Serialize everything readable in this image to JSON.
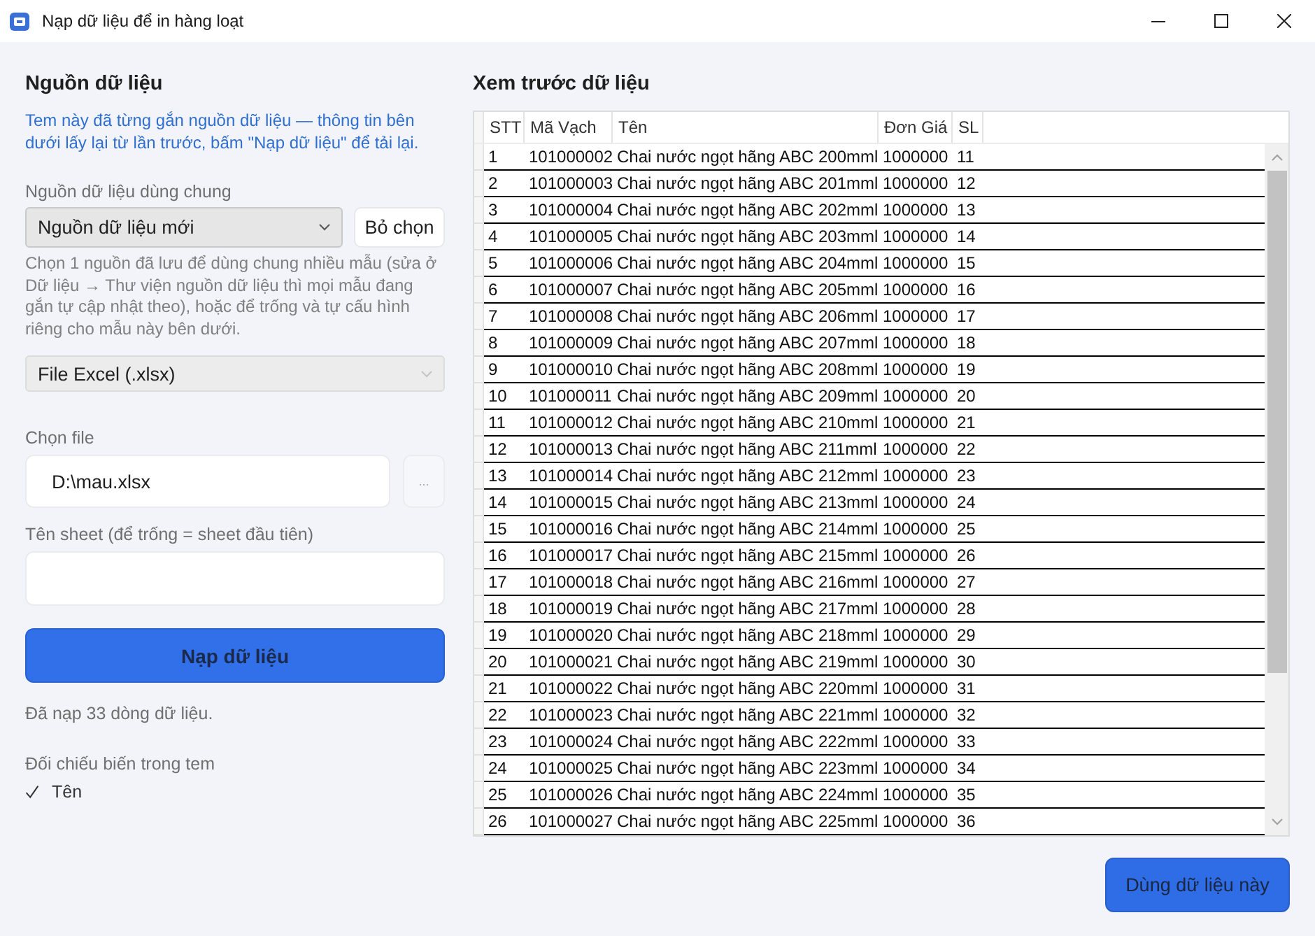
{
  "window": {
    "title": "Nạp dữ liệu để in hàng loạt"
  },
  "source_panel": {
    "heading": "Nguồn dữ liệu",
    "note": "Tem này đã từng gắn nguồn dữ liệu — thông tin bên dưới lấy lại từ lần trước, bấm \"Nạp dữ liệu\" để tải lại.",
    "shared_source": {
      "label": "Nguồn dữ liệu dùng chung",
      "value": "Nguồn dữ liệu mới",
      "disabled": false
    },
    "clear_button": "Bỏ chọn",
    "shared_hint": "Chọn 1 nguồn đã lưu để dùng chung nhiều mẫu (sửa ở Dữ liệu → Thư viện nguồn dữ liệu thì mọi mẫu đang gắn tự cập nhật theo), hoặc để trống và tự cấu hình riêng cho mẫu này bên dưới.",
    "source_type": {
      "value": "File Excel (.xlsx)",
      "disabled": true
    },
    "file": {
      "label": "Chọn file",
      "value": "D:\\mau.xlsx",
      "browse_button": "..."
    },
    "sheet": {
      "label": "Tên sheet (để trống = sheet đầu tiên)"
    },
    "load_button": "Nạp dữ liệu",
    "status": "Đã nạp 33 dòng dữ liệu.",
    "variables": {
      "label": "Đối chiếu biến trong tem",
      "items": [
        {
          "name": "Tên",
          "checked": true
        }
      ]
    }
  },
  "preview": {
    "heading": "Xem trước dữ liệu",
    "table": {
      "columns": [
        "STT",
        "Mã Vạch",
        "Tên",
        "Đơn Giá",
        "SL"
      ],
      "rows": [
        [
          "1",
          "101000002",
          "Chai nước ngọt hãng ABC 200mml",
          "1000000",
          "11"
        ],
        [
          "2",
          "101000003",
          "Chai nước ngọt hãng ABC 201mml",
          "1000000",
          "12"
        ],
        [
          "3",
          "101000004",
          "Chai nước ngọt hãng ABC 202mml",
          "1000000",
          "13"
        ],
        [
          "4",
          "101000005",
          "Chai nước ngọt hãng ABC 203mml",
          "1000000",
          "14"
        ],
        [
          "5",
          "101000006",
          "Chai nước ngọt hãng ABC 204mml",
          "1000000",
          "15"
        ],
        [
          "6",
          "101000007",
          "Chai nước ngọt hãng ABC 205mml",
          "1000000",
          "16"
        ],
        [
          "7",
          "101000008",
          "Chai nước ngọt hãng ABC 206mml",
          "1000000",
          "17"
        ],
        [
          "8",
          "101000009",
          "Chai nước ngọt hãng ABC 207mml",
          "1000000",
          "18"
        ],
        [
          "9",
          "101000010",
          "Chai nước ngọt hãng ABC 208mml",
          "1000000",
          "19"
        ],
        [
          "10",
          "101000011",
          "Chai nước ngọt hãng ABC 209mml",
          "1000000",
          "20"
        ],
        [
          "11",
          "101000012",
          "Chai nước ngọt hãng ABC 210mml",
          "1000000",
          "21"
        ],
        [
          "12",
          "101000013",
          "Chai nước ngọt hãng ABC 211mml",
          "1000000",
          "22"
        ],
        [
          "13",
          "101000014",
          "Chai nước ngọt hãng ABC 212mml",
          "1000000",
          "23"
        ],
        [
          "14",
          "101000015",
          "Chai nước ngọt hãng ABC 213mml",
          "1000000",
          "24"
        ],
        [
          "15",
          "101000016",
          "Chai nước ngọt hãng ABC 214mml",
          "1000000",
          "25"
        ],
        [
          "16",
          "101000017",
          "Chai nước ngọt hãng ABC 215mml",
          "1000000",
          "26"
        ],
        [
          "17",
          "101000018",
          "Chai nước ngọt hãng ABC 216mml",
          "1000000",
          "27"
        ],
        [
          "18",
          "101000019",
          "Chai nước ngọt hãng ABC 217mml",
          "1000000",
          "28"
        ],
        [
          "19",
          "101000020",
          "Chai nước ngọt hãng ABC 218mml",
          "1000000",
          "29"
        ],
        [
          "20",
          "101000021",
          "Chai nước ngọt hãng ABC 219mml",
          "1000000",
          "30"
        ],
        [
          "21",
          "101000022",
          "Chai nước ngọt hãng ABC 220mml",
          "1000000",
          "31"
        ],
        [
          "22",
          "101000023",
          "Chai nước ngọt hãng ABC 221mml",
          "1000000",
          "32"
        ],
        [
          "23",
          "101000024",
          "Chai nước ngọt hãng ABC 222mml",
          "1000000",
          "33"
        ],
        [
          "24",
          "101000025",
          "Chai nước ngọt hãng ABC 223mml",
          "1000000",
          "34"
        ],
        [
          "25",
          "101000026",
          "Chai nước ngọt hãng ABC 224mml",
          "1000000",
          "35"
        ],
        [
          "26",
          "101000027",
          "Chai nước ngọt hãng ABC 225mml",
          "1000000",
          "36"
        ]
      ]
    }
  },
  "use_button": "Dùng dữ liệu này"
}
